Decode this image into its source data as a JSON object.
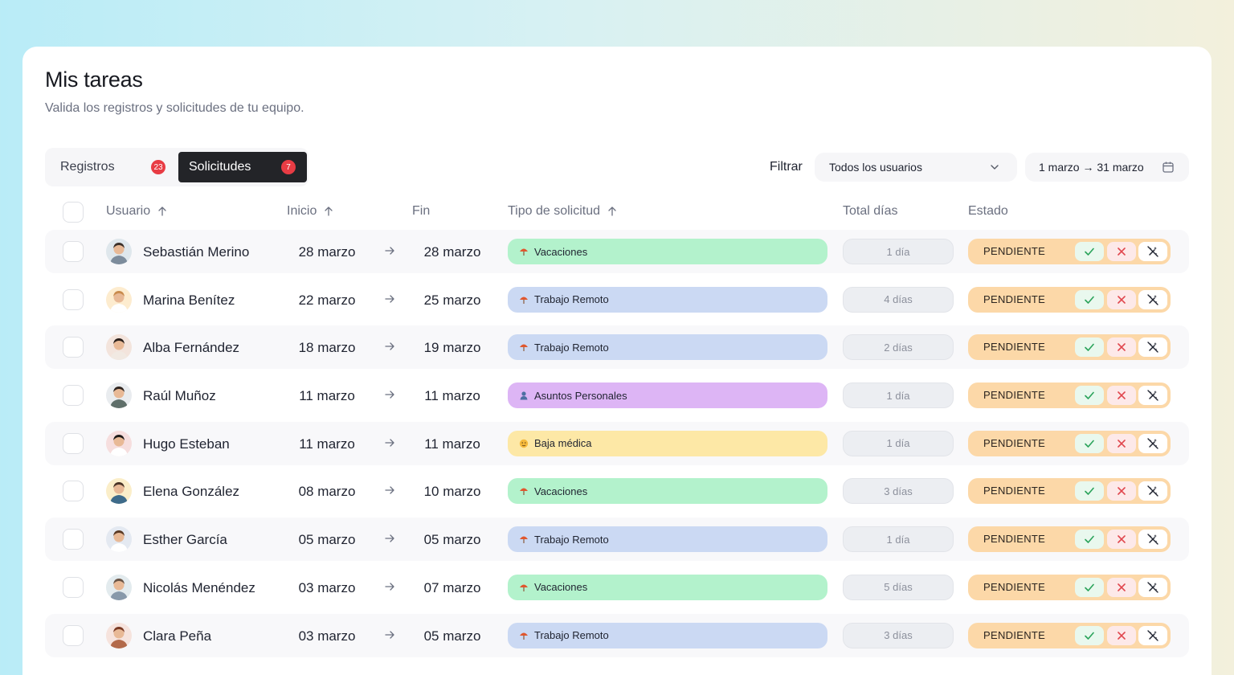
{
  "header": {
    "title": "Mis tareas",
    "subtitle": "Valida los registros y solicitudes de tu equipo."
  },
  "tabs": [
    {
      "label": "Registros",
      "count": "23"
    },
    {
      "label": "Solicitudes",
      "count": "7"
    }
  ],
  "filters": {
    "label": "Filtrar",
    "users_value": "Todos los usuarios",
    "date_range": "1 marzo → 31 marzo"
  },
  "columns": {
    "user": "Usuario",
    "start": "Inicio",
    "end": "Fin",
    "type": "Tipo de solicitud",
    "total": "Total días",
    "status": "Estado"
  },
  "colors": {
    "vacaciones": "#b3f2cc",
    "remoto": "#cbd9f3",
    "personales": "#ddb5f5",
    "baja": "#fde8a6",
    "status": "#fcd8a8"
  },
  "rows": [
    {
      "user": "Sebastián Merino",
      "start": "28 marzo",
      "end": "28 marzo",
      "type": "Vacaciones",
      "kind": "vacaciones",
      "days": "1 día",
      "status": "PENDIENTE"
    },
    {
      "user": "Marina Benítez",
      "start": "22 marzo",
      "end": "25 marzo",
      "type": "Trabajo Remoto",
      "kind": "remoto",
      "days": "4 días",
      "status": "PENDIENTE"
    },
    {
      "user": "Alba Fernández",
      "start": "18 marzo",
      "end": "19 marzo",
      "type": "Trabajo Remoto",
      "kind": "remoto",
      "days": "2 días",
      "status": "PENDIENTE"
    },
    {
      "user": "Raúl Muñoz",
      "start": "11 marzo",
      "end": "11 marzo",
      "type": "Asuntos Personales",
      "kind": "personales",
      "days": "1 día",
      "status": "PENDIENTE"
    },
    {
      "user": "Hugo Esteban",
      "start": "11 marzo",
      "end": "11 marzo",
      "type": "Baja médica",
      "kind": "baja",
      "days": "1 día",
      "status": "PENDIENTE"
    },
    {
      "user": "Elena González",
      "start": "08 marzo",
      "end": "10 marzo",
      "type": "Vacaciones",
      "kind": "vacaciones",
      "days": "3 días",
      "status": "PENDIENTE"
    },
    {
      "user": "Esther García",
      "start": "05 marzo",
      "end": "05 marzo",
      "type": "Trabajo Remoto",
      "kind": "remoto",
      "days": "1 día",
      "status": "PENDIENTE"
    },
    {
      "user": "Nicolás Menéndez",
      "start": "03 marzo",
      "end": "07 marzo",
      "type": "Vacaciones",
      "kind": "vacaciones",
      "days": "5 días",
      "status": "PENDIENTE"
    },
    {
      "user": "Clara Peña",
      "start": "03 marzo",
      "end": "05 marzo",
      "type": "Trabajo Remoto",
      "kind": "remoto",
      "days": "3 días",
      "status": "PENDIENTE"
    }
  ]
}
